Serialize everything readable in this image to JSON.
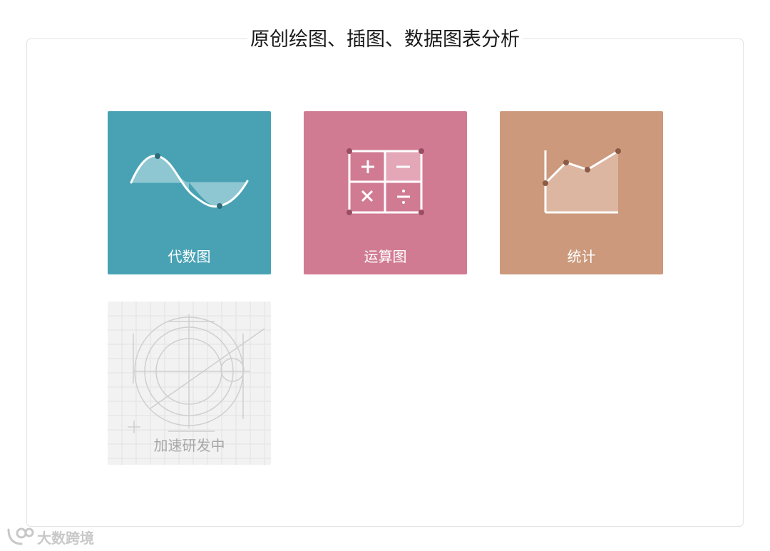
{
  "page": {
    "title": "原创绘图、插图、数据图表分析"
  },
  "tiles": [
    {
      "label": "代数图",
      "color": "#48a2b4",
      "icon": "sine-wave-icon"
    },
    {
      "label": "运算图",
      "color": "#d17b93",
      "icon": "calculator-icon"
    },
    {
      "label": "统计",
      "color": "#cc997c",
      "icon": "area-chart-icon"
    },
    {
      "label": "加速研发中",
      "color": "#f2f2f2",
      "icon": "sketch-drawing-icon"
    }
  ],
  "watermark": {
    "text": "大数跨境",
    "icon": "bird-logo-icon"
  }
}
